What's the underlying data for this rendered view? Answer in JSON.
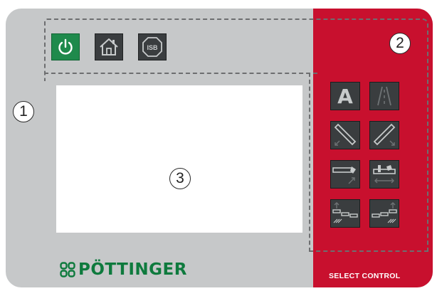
{
  "top_buttons": [
    {
      "icon": "power-icon"
    },
    {
      "icon": "home-icon"
    },
    {
      "icon": "isb-icon",
      "label": "ISB"
    }
  ],
  "callouts": {
    "one": "1",
    "two": "2",
    "three": "3"
  },
  "side_buttons": [
    {
      "icon": "auto-mode-icon",
      "label": "A"
    },
    {
      "icon": "tramline-icon"
    },
    {
      "icon": "left-diagonal-icon"
    },
    {
      "icon": "right-diagonal-icon"
    },
    {
      "icon": "left-boom-tilt-icon"
    },
    {
      "icon": "right-boom-tilt-icon"
    },
    {
      "icon": "left-section-lift-icon"
    },
    {
      "icon": "right-section-lift-icon"
    }
  ],
  "brand": {
    "name": "PÖTTINGER"
  },
  "select_control_label": "SELECT CONTROL",
  "colors": {
    "panel": "#c6c8c9",
    "accent_red": "#c8102e",
    "power_green": "#1f8a4c",
    "brand_green": "#0e7a3d",
    "button_dark": "#3a3d3f"
  }
}
